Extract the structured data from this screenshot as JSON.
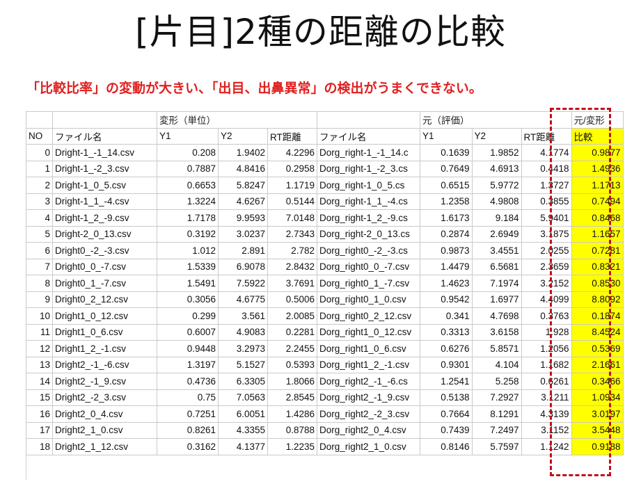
{
  "title": "[片目]2種の距離の比較",
  "subtitle": "「比較比率」の変動が大きい、「出目、出鼻異常」の検出がうまくできない。",
  "colors": {
    "subtitle": "#e02020",
    "highlight": "#ffff00",
    "dash_box": "#c0101c"
  },
  "table": {
    "group_headers": {
      "deformed": "変形（単位）",
      "original": "元（評価）",
      "ratio": "元/変形"
    },
    "columns": [
      "NO",
      "ファイル名",
      "Y1",
      "Y2",
      "RT距離",
      "ファイル名",
      "Y1",
      "Y2",
      "RT距離",
      "比較"
    ],
    "rows": [
      [
        "0",
        "Dright-1_-1_14.csv",
        "0.208",
        "1.9402",
        "4.2296",
        "Dorg_right-1_-1_14.c",
        "0.1639",
        "1.9852",
        "4.1774",
        "0.9877"
      ],
      [
        "1",
        "Dright-1_-2_3.csv",
        "0.7887",
        "4.8416",
        "0.2958",
        "Dorg_right-1_-2_3.cs",
        "0.7649",
        "4.6913",
        "0.4418",
        "1.4936"
      ],
      [
        "2",
        "Dright-1_0_5.csv",
        "0.6653",
        "5.8247",
        "1.1719",
        "Dorg_right-1_0_5.cs",
        "0.6515",
        "5.9772",
        "1.3727",
        "1.1713"
      ],
      [
        "3",
        "Dright-1_1_-4.csv",
        "1.3224",
        "4.6267",
        "0.5144",
        "Dorg_right-1_1_-4.cs",
        "1.2358",
        "4.9808",
        "0.3855",
        "0.7494"
      ],
      [
        "4",
        "Dright-1_2_-9.csv",
        "1.7178",
        "9.9593",
        "7.0148",
        "Dorg_right-1_2_-9.cs",
        "1.6173",
        "9.184",
        "5.9401",
        "0.8468"
      ],
      [
        "5",
        "Dright-2_0_13.csv",
        "0.3192",
        "3.0237",
        "2.7343",
        "Dorg_right-2_0_13.cs",
        "0.2874",
        "2.6949",
        "3.1875",
        "1.1657"
      ],
      [
        "6",
        "Dright0_-2_-3.csv",
        "1.012",
        "2.891",
        "2.782",
        "Dorg_right0_-2_-3.cs",
        "0.9873",
        "3.4551",
        "2.0255",
        "0.7281"
      ],
      [
        "7",
        "Dright0_0_-7.csv",
        "1.5339",
        "6.9078",
        "2.8432",
        "Dorg_right0_0_-7.csv",
        "1.4479",
        "6.5681",
        "2.3659",
        "0.8321"
      ],
      [
        "8",
        "Dright0_1_-7.csv",
        "1.5491",
        "7.5922",
        "3.7691",
        "Dorg_right0_1_-7.csv",
        "1.4623",
        "7.1974",
        "3.2152",
        "0.8530"
      ],
      [
        "9",
        "Dright0_2_12.csv",
        "0.3056",
        "4.6775",
        "0.5006",
        "Dorg_right0_1_0.csv",
        "0.9542",
        "1.6977",
        "4.4099",
        "8.8092"
      ],
      [
        "10",
        "Dright1_0_12.csv",
        "0.299",
        "3.561",
        "2.0085",
        "Dorg_right0_2_12.csv",
        "0.341",
        "4.7698",
        "0.3763",
        "0.1874"
      ],
      [
        "11",
        "Dright1_0_6.csv",
        "0.6007",
        "4.9083",
        "0.2281",
        "Dorg_right1_0_12.csv",
        "0.3313",
        "3.6158",
        "1.928",
        "8.4524"
      ],
      [
        "12",
        "Dright1_2_-1.csv",
        "0.9448",
        "3.2973",
        "2.2455",
        "Dorg_right1_0_6.csv",
        "0.6276",
        "5.8571",
        "1.2056",
        "0.5369"
      ],
      [
        "13",
        "Dright2_-1_-6.csv",
        "1.3197",
        "5.1527",
        "0.5393",
        "Dorg_right1_2_-1.csv",
        "0.9301",
        "4.104",
        "1.1682",
        "2.1661"
      ],
      [
        "14",
        "Dright2_-1_9.csv",
        "0.4736",
        "6.3305",
        "1.8066",
        "Dorg_right2_-1_-6.cs",
        "1.2541",
        "5.258",
        "0.6261",
        "0.3466"
      ],
      [
        "15",
        "Dright2_-2_3.csv",
        "0.75",
        "7.0563",
        "2.8545",
        "Dorg_right2_-1_9.csv",
        "0.5138",
        "7.2927",
        "3.1211",
        "1.0934"
      ],
      [
        "16",
        "Dright2_0_4.csv",
        "0.7251",
        "6.0051",
        "1.4286",
        "Dorg_right2_-2_3.csv",
        "0.7664",
        "8.1291",
        "4.3139",
        "3.0197"
      ],
      [
        "17",
        "Dright2_1_0.csv",
        "0.8261",
        "4.3355",
        "0.8788",
        "Dorg_right2_0_4.csv",
        "0.7439",
        "7.2497",
        "3.1152",
        "3.5448"
      ],
      [
        "18",
        "Dright2_1_12.csv",
        "0.3162",
        "4.1377",
        "1.2235",
        "Dorg_right2_1_0.csv",
        "0.8146",
        "5.7597",
        "1.1242",
        "0.9188"
      ]
    ]
  }
}
